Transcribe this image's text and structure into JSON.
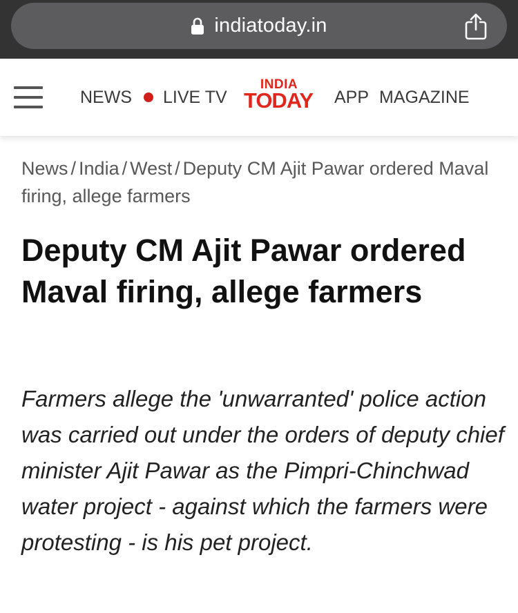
{
  "browser": {
    "url": "indiatoday.in",
    "icons": [
      "lock-icon",
      "share-icon"
    ]
  },
  "header": {
    "menu_icon": "hamburger-icon",
    "nav": {
      "news": "NEWS",
      "live_tv": "LIVE TV",
      "app": "APP",
      "magazine": "MAGAZINE"
    },
    "logo": {
      "line1": "INDIA",
      "line2": "TODAY"
    },
    "colors": {
      "brand_red": "#e1261c",
      "live_dot": "#d0201c"
    }
  },
  "breadcrumb": {
    "items": [
      "News",
      "India",
      "West"
    ],
    "separator": "/",
    "current": "Deputy CM Ajit Pawar ordered Maval firing, allege farmers"
  },
  "article": {
    "headline": "Deputy CM Ajit Pawar ordered Maval firing, allege farmers",
    "summary": "Farmers allege the 'unwarranted' police action was carried out under the orders of deputy chief minister Ajit Pawar as the Pimpri-Chinchwad water project - against which the farmers were protesting - is his pet project."
  }
}
